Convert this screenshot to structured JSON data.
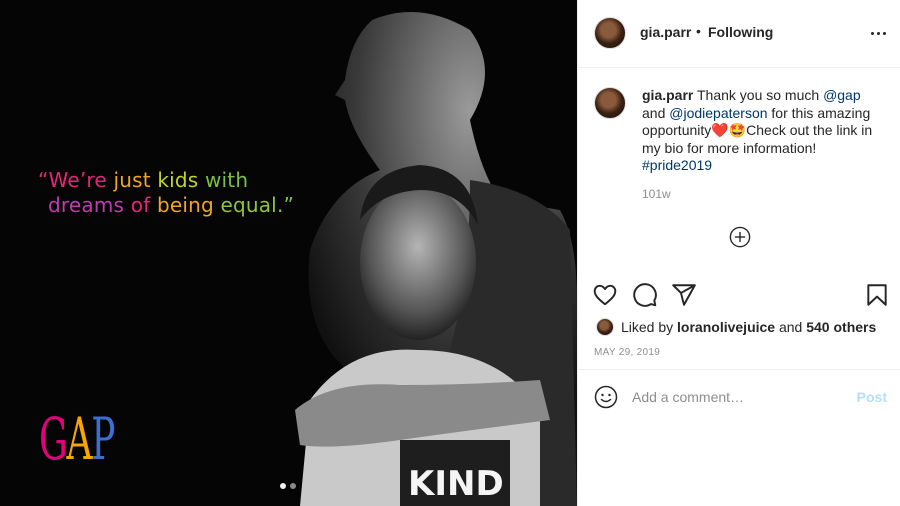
{
  "media": {
    "quote_parts_line1": [
      {
        "text": "“We’re ",
        "color": "#e8247a"
      },
      {
        "text": "just ",
        "color": "#f2a51e"
      },
      {
        "text": "kids ",
        "color": "#c4d426"
      },
      {
        "text": "with",
        "color": "#7bc043"
      }
    ],
    "quote_parts_line2": [
      {
        "text": "dreams ",
        "color": "#c13bb0"
      },
      {
        "text": "of ",
        "color": "#e8247a"
      },
      {
        "text": "being ",
        "color": "#f2a51e"
      },
      {
        "text": "equal.",
        "color": "#8cc63f"
      },
      {
        "text": "”",
        "color": "#7bc043"
      }
    ],
    "logo_letters": [
      {
        "text": "G",
        "color": "#e3007e"
      },
      {
        "text": "A",
        "color": "#f7a600"
      },
      {
        "text": "P",
        "color": "#3d6fd1"
      }
    ],
    "carousel_dots": 2,
    "carousel_active": 0
  },
  "header": {
    "username": "gia.parr",
    "separator": "•",
    "follow_status": "Following"
  },
  "caption": {
    "username": "gia.parr",
    "text_1": " Thank you so much ",
    "mention_1": "@gap",
    "text_2": " and ",
    "mention_2": "@jodiepaterson",
    "text_3": " for this amazing opportunity❤️🤩Check out the link in my bio for more information! ",
    "hashtag": "#pride2019",
    "time_ago": "101w"
  },
  "likes": {
    "prefix": "Liked by ",
    "liker": "loranolivejuice",
    "middle": " and ",
    "others": "540 others"
  },
  "post_date": "MAY 29, 2019",
  "comment": {
    "placeholder": "Add a comment…",
    "post_label": "Post"
  },
  "colors": {
    "link": "#00376b",
    "muted": "#8e8e8e",
    "post_disabled": "#b2dffc"
  },
  "icons": [
    "more-icon",
    "load-more-icon",
    "heart-icon",
    "comment-icon",
    "share-icon",
    "bookmark-icon",
    "emoji-icon"
  ]
}
